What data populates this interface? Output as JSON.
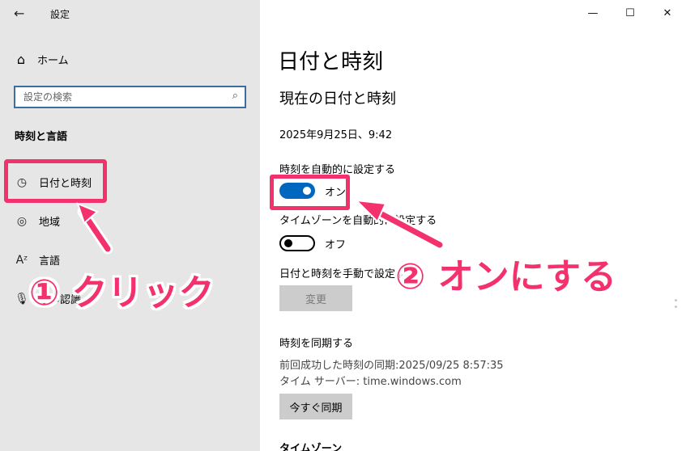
{
  "window": {
    "title": "設定",
    "back_icon": "back-arrow-icon",
    "controls": [
      "minimize-icon",
      "maximize-icon",
      "close-icon"
    ]
  },
  "sidebar": {
    "home_label": "ホーム",
    "search_placeholder": "設定の検索",
    "section_label": "時刻と言語",
    "items": [
      {
        "label": "日付と時刻",
        "icon": "date-time-icon"
      },
      {
        "label": "地域",
        "icon": "region-icon"
      },
      {
        "label": "言語",
        "icon": "language-icon"
      },
      {
        "label": "音声認識",
        "icon": "microphone-icon"
      }
    ]
  },
  "main": {
    "title": "日付と時刻",
    "subtitle": "現在の日付と時刻",
    "current_datetime": "2025年9月25日、9:42",
    "auto_time": {
      "label": "時刻を自動的に設定する",
      "state": "オン",
      "on": true
    },
    "auto_timezone": {
      "label": "タイムゾーンを自動的に設定する",
      "state": "オフ",
      "on": false
    },
    "manual": {
      "label": "日付と時刻を手動で設定する",
      "button": "変更"
    },
    "sync": {
      "heading": "時刻を同期する",
      "last_sync": "前回成功した時刻の同期:2025/09/25 8:57:35",
      "server": "タイム サーバー: time.windows.com",
      "button": "今すぐ同期"
    },
    "next_heading": "タイムゾーン"
  },
  "annotations": {
    "step1": "① クリック",
    "step2": "② オンにする",
    "color": "#f2316d"
  },
  "colors": {
    "accent": "#0067c0",
    "sidebar_bg": "#e6e6e6"
  }
}
